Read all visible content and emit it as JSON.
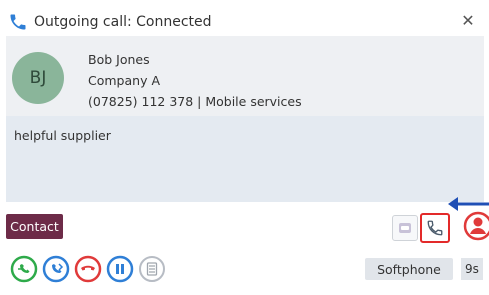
{
  "title": "Outgoing call: Connected",
  "contact": {
    "initials": "BJ",
    "name": "Bob Jones",
    "company": "Company A",
    "phone_line": "(07825) 112 378 | Mobile services"
  },
  "notes": "helpful supplier",
  "contact_tag": "Contact",
  "status": {
    "device": "Softphone",
    "timer": "9s"
  },
  "colors": {
    "contact_tag": "#6d2b48",
    "avatar": "#8ab59a",
    "call_green": "#2eaa4a",
    "call_blue": "#2f7fd6",
    "call_red": "#e03a3a",
    "highlight": "#e32a2a"
  },
  "icons": {
    "title": "phone-icon",
    "close": "close-icon",
    "grey_btn": "voicemail-icon",
    "highlight_btn": "phone-handset-icon",
    "alert": "user-alert-icon",
    "controls": [
      "transfer-in-icon",
      "transfer-out-icon",
      "hang-up-icon",
      "pause-icon",
      "keypad-icon"
    ]
  }
}
